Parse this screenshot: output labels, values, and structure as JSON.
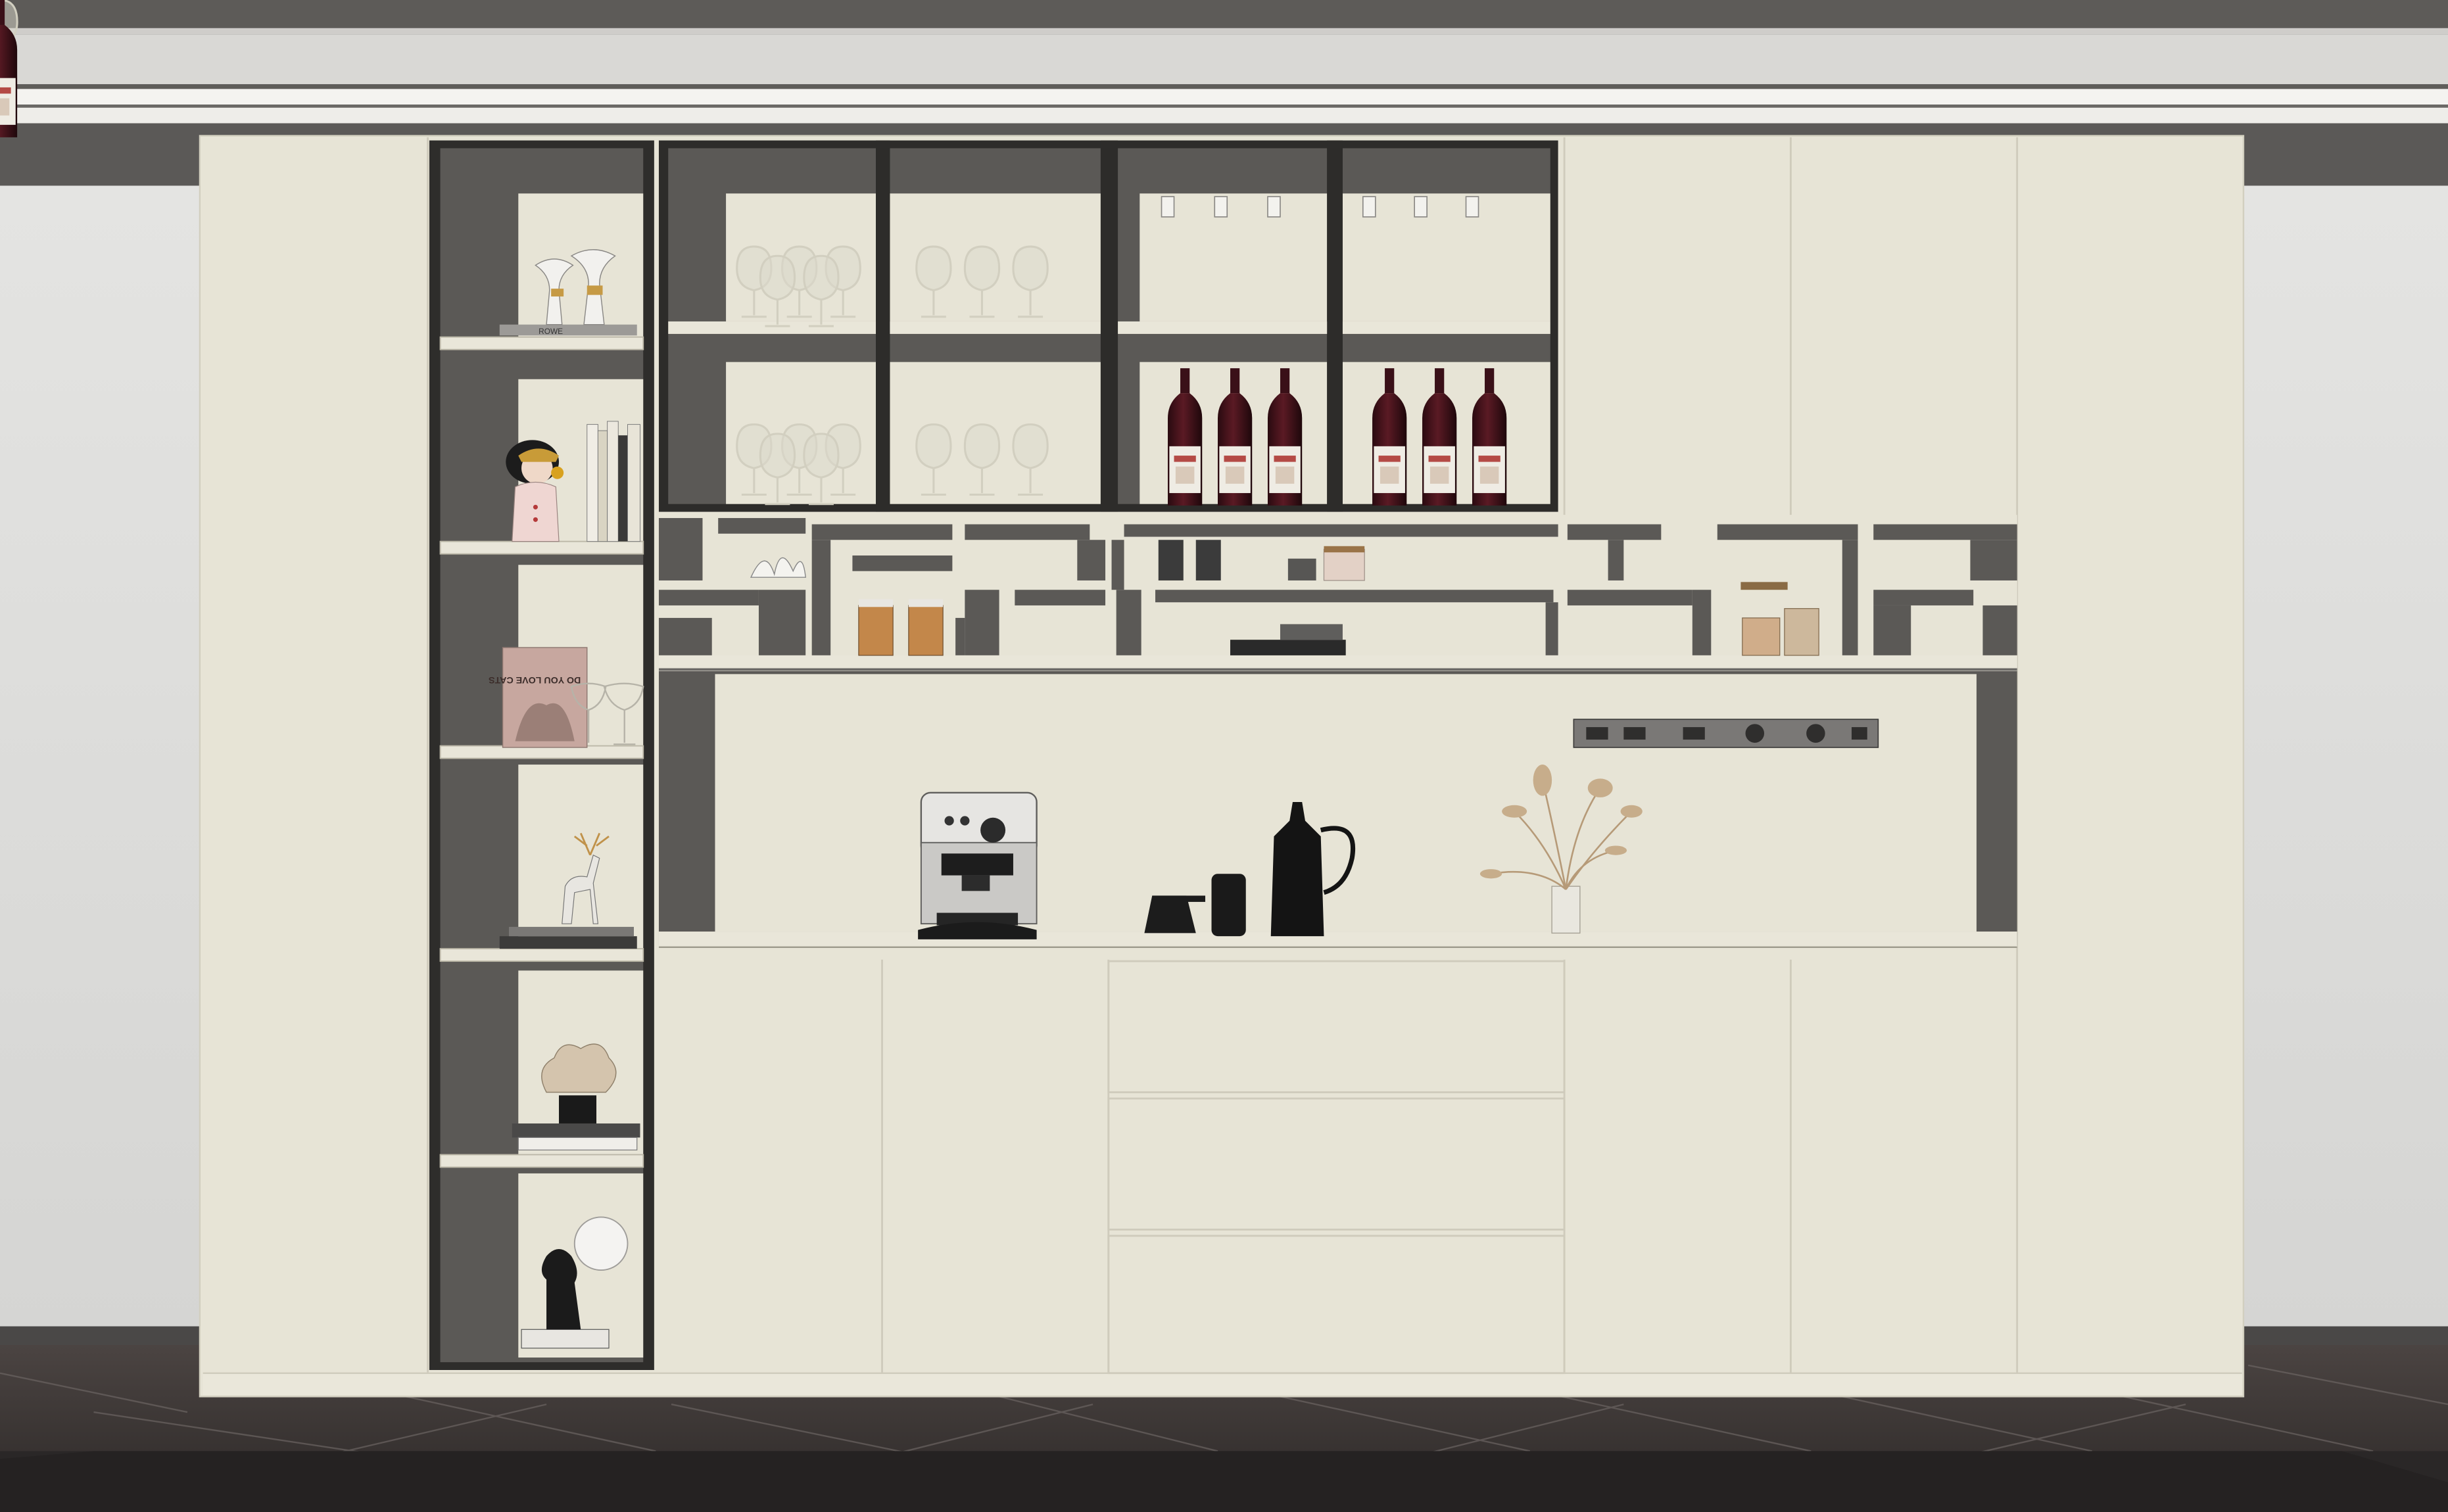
{
  "scene": {
    "subject": "",
    "colors": {
      "cabinet": "#e7e4d6",
      "frame": "#55534f",
      "dark_frame": "#2c2b2a",
      "wall": "#dcdcda",
      "ceiling": "#f1f0ec",
      "floor": "#3a3534",
      "wine_red": "#3d1018",
      "glass": "#d8d6c7"
    },
    "counts": {
      "wine_bottles": 6,
      "wine_glasses_visible": 16,
      "shelves_left_column": 6,
      "drawers": 3
    }
  },
  "book_spines": [
    "ROWE",
    "DO YOU LOVE CATS"
  ]
}
